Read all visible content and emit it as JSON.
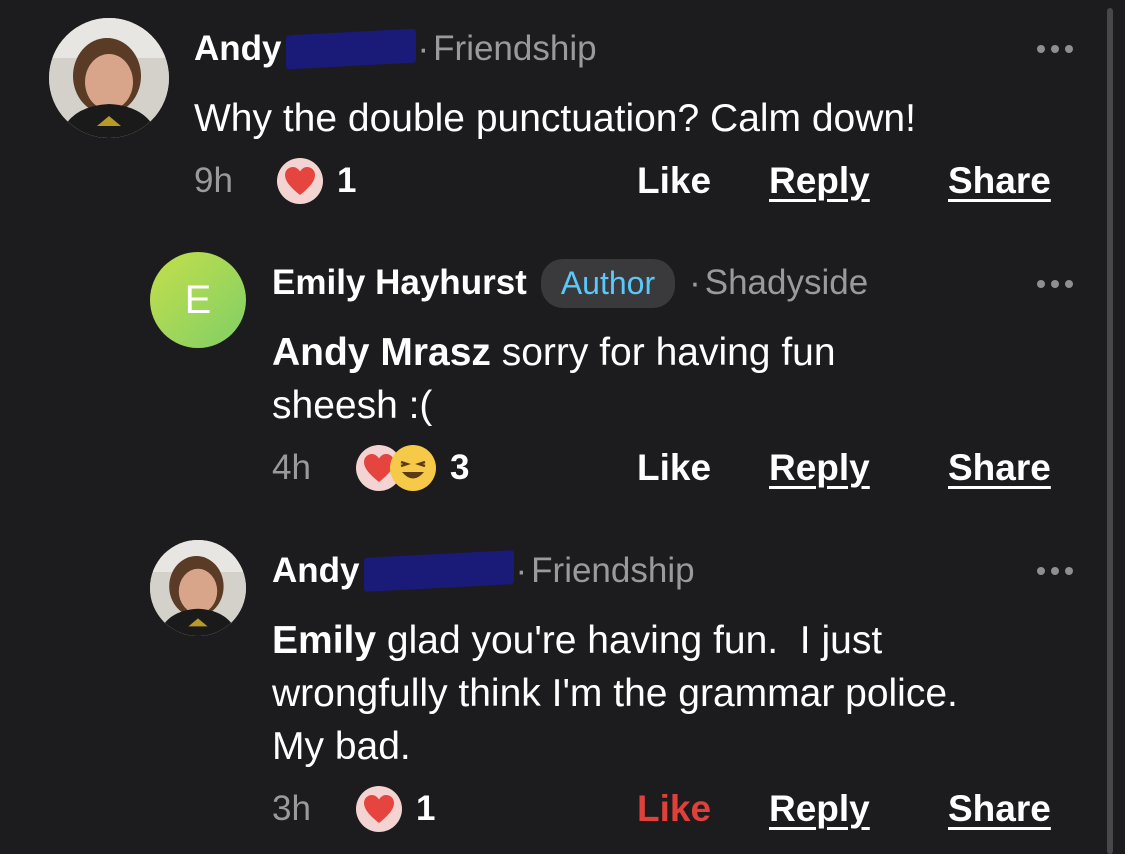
{
  "comments": [
    {
      "author": "Andy",
      "location": "Friendship",
      "badge": "",
      "body_mention": "",
      "body": "Why the double punctuation? Calm down!",
      "time": "9h",
      "reaction_count": "1",
      "reactions": [
        "heart"
      ],
      "like_label": "Like",
      "reply_label": "Reply",
      "share_label": "Share",
      "liked": false
    },
    {
      "author": "Emily Hayhurst",
      "avatar_letter": "E",
      "badge": "Author",
      "location": "Shadyside",
      "body_mention": "Andy Mrasz",
      "body": " sorry for having fun sheesh :(",
      "time": "4h",
      "reaction_count": "3",
      "reactions": [
        "heart",
        "laugh"
      ],
      "like_label": "Like",
      "reply_label": "Reply",
      "share_label": "Share",
      "liked": false
    },
    {
      "author": "Andy",
      "location": "Friendship",
      "badge": "",
      "body_mention": "Emily",
      "body": " glad you're having fun.  I just wrongfully think I'm the grammar police. My bad.",
      "time": "3h",
      "reaction_count": "1",
      "reactions": [
        "heart"
      ],
      "like_label": "Like",
      "reply_label": "Reply",
      "share_label": "Share",
      "liked": true
    }
  ],
  "separator": "·",
  "icons": {
    "more": "more-icon",
    "heart": "heart-reaction-icon",
    "laugh": "laugh-reaction-icon"
  },
  "colors": {
    "background": "#1c1c1e",
    "secondary_text": "#9a9a9e",
    "author_badge_text": "#5ac8fa",
    "liked": "#e0403a",
    "redaction": "#1a1a78"
  }
}
